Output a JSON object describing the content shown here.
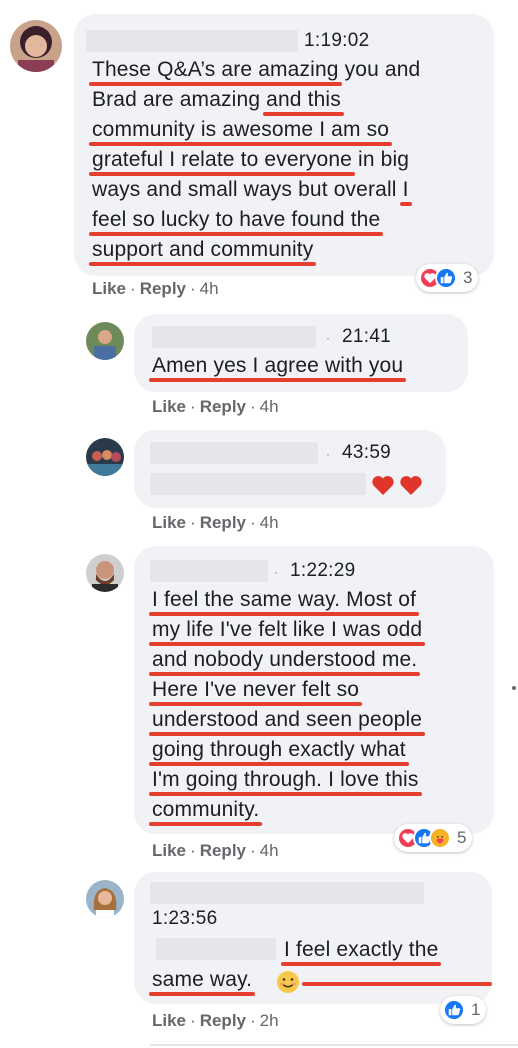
{
  "actions": {
    "like": "Like",
    "reply": "Reply",
    "separator": "·"
  },
  "colors": {
    "underline": "#e53e2e",
    "bubble": "#f0f2f5",
    "love": "#f33e58",
    "like": "#1877f2",
    "care": "#f7b125"
  },
  "comments": [
    {
      "timestamp": "1:19:02",
      "lines": [
        [
          {
            "t": "These Q&A’s are amazing",
            "u": true
          },
          {
            "t": " you and",
            "u": false
          }
        ],
        [
          {
            "t": "Brad are amazing ",
            "u": false
          },
          {
            "t": "and this",
            "u": true
          }
        ],
        [
          {
            "t": "community is awesome I am so",
            "u": true
          }
        ],
        [
          {
            "t": "grateful I relate to everyone",
            "u": true
          },
          {
            "t": " in big",
            "u": false
          }
        ],
        [
          {
            "t": "ways and small ways but overall ",
            "u": false
          },
          {
            "t": "I",
            "u": true
          }
        ],
        [
          {
            "t": "feel so lucky to have found the",
            "u": true
          }
        ],
        [
          {
            "t": "support and community",
            "u": true
          }
        ]
      ],
      "time": "4h",
      "reaction_count": "3",
      "reactions": [
        "love-icon",
        "like-icon"
      ]
    },
    {
      "timestamp": "21:41",
      "lines": [
        [
          {
            "t": "Amen yes I agree with you",
            "u": true
          }
        ]
      ],
      "time": "4h"
    },
    {
      "timestamp": "43:59",
      "emoji": "❤❤",
      "time": "4h"
    },
    {
      "timestamp": "1:22:29",
      "lines": [
        [
          {
            "t": "I feel the same way. Most of",
            "u": true
          }
        ],
        [
          {
            "t": "my life I've felt like I was odd",
            "u": true
          }
        ],
        [
          {
            "t": "and nobody understood me.",
            "u": true
          }
        ],
        [
          {
            "t": "Here I've never felt so",
            "u": true
          }
        ],
        [
          {
            "t": "understood and seen people",
            "u": true
          }
        ],
        [
          {
            "t": "going through exactly what",
            "u": true
          }
        ],
        [
          {
            "t": "I'm going through. I love this",
            "u": true
          }
        ],
        [
          {
            "t": "community.",
            "u": true
          }
        ]
      ],
      "time": "4h",
      "reaction_count": "5",
      "reactions": [
        "love-icon",
        "like-icon",
        "care-icon"
      ]
    },
    {
      "timestamp": "1:23:56",
      "lines": [
        [
          {
            "t": "I feel exactly the",
            "u": true
          }
        ],
        [
          {
            "t": "same way.",
            "u": true
          }
        ]
      ],
      "time": "2h",
      "reaction_count": "1",
      "reactions": [
        "like-icon"
      ]
    }
  ]
}
